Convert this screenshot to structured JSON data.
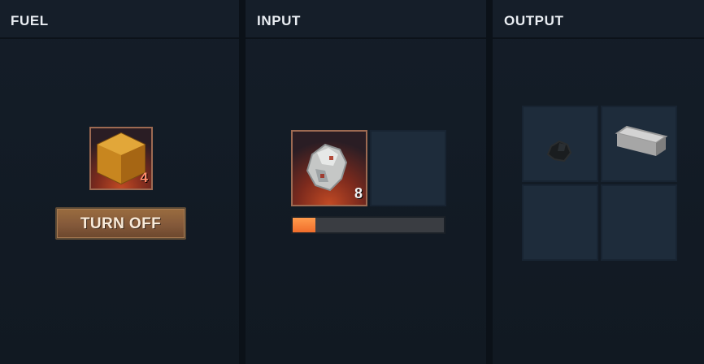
{
  "panels": {
    "fuel": {
      "title": "FUEL",
      "slot": {
        "item": "coal-block",
        "count": "4"
      },
      "button_label": "TURN OFF"
    },
    "input": {
      "title": "INPUT",
      "slots": [
        {
          "item": "iron-ore",
          "count": "8"
        },
        {
          "item": "empty",
          "count": ""
        }
      ],
      "progress": 0.15
    },
    "output": {
      "title": "OUTPUT",
      "slots": [
        {
          "item": "charcoal"
        },
        {
          "item": "iron-ingot"
        },
        {
          "item": "empty"
        },
        {
          "item": "empty"
        }
      ]
    }
  },
  "colors": {
    "accent_progress": "#f06d2b",
    "button_brown": "#84593a",
    "slot_bg": "#1e2c3b",
    "active_slot_glow": "#c24a24"
  }
}
